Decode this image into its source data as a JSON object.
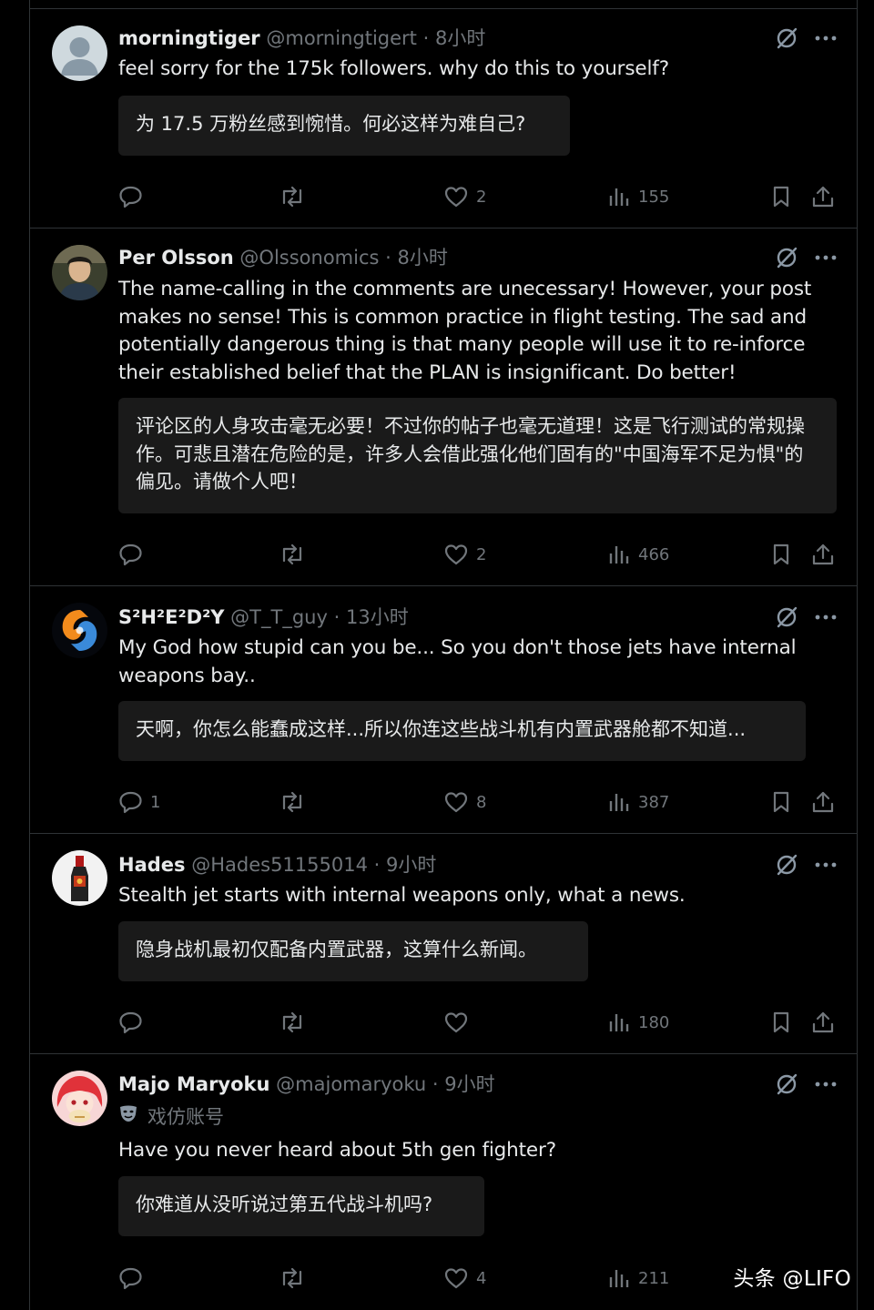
{
  "tweets": [
    {
      "name": "morningtiger",
      "handle": "@morningtigert",
      "separator": "·",
      "time": "8小时",
      "text": "feel sorry for the 175k followers. why do this to yourself?",
      "translation": "为 17.5 万粉丝感到惋惜。何必这样为难自己?",
      "replies": "",
      "likes": "2",
      "views": "155",
      "avatar_icon": "default-avatar-icon"
    },
    {
      "name": "Per Olsson",
      "handle": "@Olssonomics",
      "separator": "·",
      "time": "8小时",
      "text": "The name-calling in the comments are unecessary! However, your post makes no sense! This is common practice in flight testing. The sad and potentially dangerous thing is that many people will use it to re-inforce their established belief that the PLAN is insignificant. Do better!",
      "translation": "评论区的人身攻击毫无必要！不过你的帖子也毫无道理！这是飞行测试的常规操作。可悲且潜在危险的是，许多人会借此强化他们固有的\"中国海军不足为惧\"的偏见。请做个人吧！",
      "replies": "",
      "likes": "2",
      "views": "466",
      "avatar_icon": "person-photo-avatar"
    },
    {
      "name": "S²H²E²D²Y",
      "handle": "@T_T_guy",
      "separator": "·",
      "time": "13小时",
      "text": "My God how stupid can you be... So you don't those jets have internal weapons bay..",
      "translation": "天啊，你怎么能蠢成这样...所以你连这些战斗机有内置武器舱都不知道...",
      "replies": "1",
      "likes": "8",
      "views": "387",
      "avatar_icon": "fire-ice-swirl-avatar"
    },
    {
      "name": "Hades",
      "handle": "@Hades51155014",
      "separator": "·",
      "time": "9小时",
      "text": "Stealth jet starts with internal weapons only, what a news.",
      "translation": "隐身战机最初仅配备内置武器，这算什么新闻。",
      "replies": "",
      "likes": "",
      "views": "180",
      "avatar_icon": "bottle-avatar"
    },
    {
      "name": "Majo Maryoku",
      "handle": "@majomaryoku",
      "separator": "·",
      "time": "9小时",
      "parody_label": "戏仿账号",
      "text": "Have you never heard about 5th gen fighter?",
      "translation": "你难道从没听说过第五代战斗机吗?",
      "replies": "",
      "likes": "4",
      "views": "211",
      "avatar_icon": "anime-girl-avatar"
    }
  ],
  "watermark": "头条 @LIFO",
  "colors": {
    "background": "#000000",
    "text": "#e7e9ea",
    "secondary": "#71767b",
    "divider": "#2f3336",
    "translation_bg": "#1a1a1a"
  }
}
